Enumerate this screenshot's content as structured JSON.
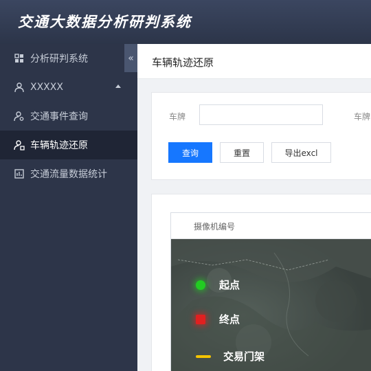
{
  "header": {
    "title": "交通大数据分析研判系统"
  },
  "sidebar": {
    "collapse_glyph": "«",
    "items": [
      {
        "label": "分析研判系统",
        "icon": "dashboard-icon"
      },
      {
        "label": "XXXXX",
        "icon": "user-icon"
      },
      {
        "label": "交通事件查询",
        "icon": "user-search-icon"
      },
      {
        "label": "车辆轨迹还原",
        "icon": "user-track-icon"
      },
      {
        "label": "交通流量数据统计",
        "icon": "chart-box-icon"
      }
    ],
    "active_index": 3
  },
  "page": {
    "title": "车辆轨迹还原"
  },
  "search": {
    "plate_label": "车牌",
    "plate_value": "",
    "plate2_label": "车牌",
    "query_label": "查询",
    "reset_label": "重置",
    "export_label": "导出excl"
  },
  "map": {
    "header_label": "摄像机编号",
    "legend": [
      {
        "label": "起点",
        "color": "#22cc22"
      },
      {
        "label": "终点",
        "color": "#e02020"
      },
      {
        "label": "交易门架",
        "color": "#f5c400"
      }
    ]
  },
  "colors": {
    "accent": "#1677ff",
    "sidebar_bg": "#2d3549",
    "sidebar_active": "#1f2535"
  }
}
